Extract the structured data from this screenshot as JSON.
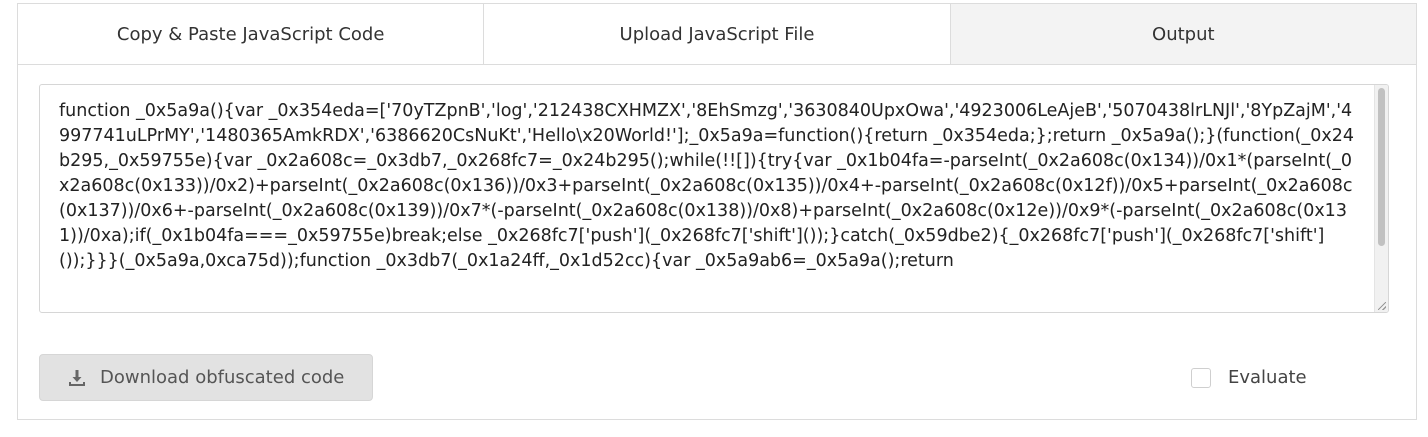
{
  "tabs": [
    {
      "label": "Copy & Paste JavaScript Code",
      "active": false
    },
    {
      "label": "Upload JavaScript File",
      "active": false
    },
    {
      "label": "Output",
      "active": true
    }
  ],
  "output": {
    "code": "function _0x5a9a(){var _0x354eda=['70yTZpnB','log','212438CXHMZX','8EhSmzg','3630840UpxOwa','4923006LeAjeB','5070438lrLNJl','8YpZajM','4997741uLPrMY','1480365AmkRDX','6386620CsNuKt','Hello\\x20World!'];_0x5a9a=function(){return _0x354eda;};return _0x5a9a();}(function(_0x24b295,_0x59755e){var _0x2a608c=_0x3db7,_0x268fc7=_0x24b295();while(!![]){try{var _0x1b04fa=-parseInt(_0x2a608c(0x134))/0x1*(parseInt(_0x2a608c(0x133))/0x2)+parseInt(_0x2a608c(0x136))/0x3+parseInt(_0x2a608c(0x135))/0x4+-parseInt(_0x2a608c(0x12f))/0x5+parseInt(_0x2a608c(0x137))/0x6+-parseInt(_0x2a608c(0x139))/0x7*(-parseInt(_0x2a608c(0x138))/0x8)+parseInt(_0x2a608c(0x12e))/0x9*(-parseInt(_0x2a608c(0x131))/0xa);if(_0x1b04fa===_0x59755e)break;else _0x268fc7['push'](_0x268fc7['shift']());}catch(_0x59dbe2){_0x268fc7['push'](_0x268fc7['shift']());}}}(_0x5a9a,0xca75d));function _0x3db7(_0x1a24ff,_0x1d52cc){var _0x5a9ab6=_0x5a9a();return"
  },
  "download": {
    "label": "Download obfuscated code"
  },
  "evaluate": {
    "label": "Evaluate",
    "checked": false
  },
  "icons": {
    "download": "download-icon"
  }
}
